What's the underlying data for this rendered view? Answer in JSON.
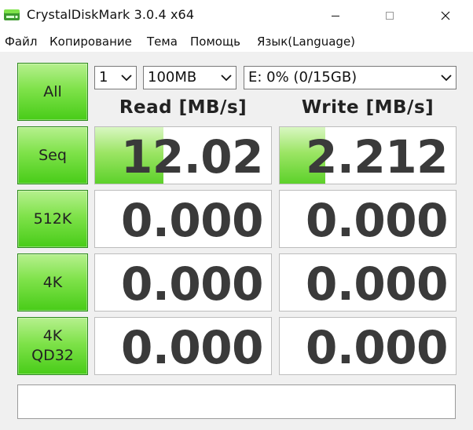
{
  "window": {
    "title": "CrystalDiskMark 3.0.4 x64",
    "icon": "disk-app-icon"
  },
  "menu": [
    "Файл",
    "Копирование",
    "Тема",
    "Помощь",
    "Язык(Language)"
  ],
  "controls": {
    "all_label": "All",
    "count": "1",
    "size": "100MB",
    "drive": "E: 0% (0/15GB)"
  },
  "headers": {
    "read": "Read [MB/s]",
    "write": "Write [MB/s]"
  },
  "tests": [
    {
      "label_lines": [
        "Seq"
      ],
      "read": "12.02",
      "write": "2.212",
      "read_fill": 0.39,
      "write_fill": 0.26
    },
    {
      "label_lines": [
        "512K"
      ],
      "read": "0.000",
      "write": "0.000",
      "read_fill": 0,
      "write_fill": 0
    },
    {
      "label_lines": [
        "4K"
      ],
      "read": "0.000",
      "write": "0.000",
      "read_fill": 0,
      "write_fill": 0
    },
    {
      "label_lines": [
        "4K",
        "QD32"
      ],
      "read": "0.000",
      "write": "0.000",
      "read_fill": 0,
      "write_fill": 0
    }
  ],
  "status_text": "",
  "colors": {
    "button_green": "#48cc18",
    "bar_green": "#5dd12a",
    "value_text": "#3a3a3a"
  }
}
